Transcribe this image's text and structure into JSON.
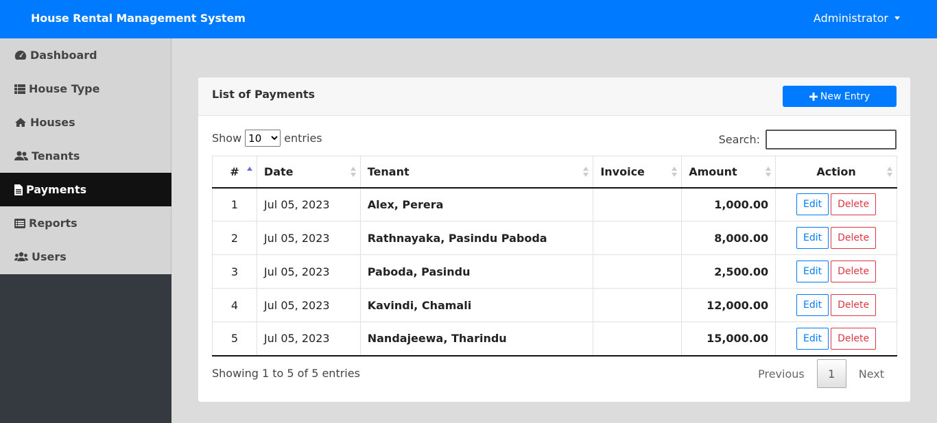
{
  "app": {
    "title": "House Rental Management System",
    "user": "Administrator"
  },
  "sidebar": {
    "items": [
      {
        "label": "Dashboard",
        "icon": "tachometer-icon"
      },
      {
        "label": "House Type",
        "icon": "th-list-icon"
      },
      {
        "label": "Houses",
        "icon": "home-icon"
      },
      {
        "label": "Tenants",
        "icon": "user-friends-icon"
      },
      {
        "label": "Payments",
        "icon": "file-invoice-icon",
        "active": true
      },
      {
        "label": "Reports",
        "icon": "list-alt-icon"
      },
      {
        "label": "Users",
        "icon": "users-icon"
      }
    ]
  },
  "card": {
    "title": "List of Payments",
    "new_entry": "New Entry"
  },
  "table_controls": {
    "show": "Show",
    "entries": "entries",
    "page_size": "10",
    "page_size_options": [
      "10"
    ],
    "search_label": "Search:",
    "search_value": ""
  },
  "table": {
    "columns": [
      "#",
      "Date",
      "Tenant",
      "Invoice",
      "Amount",
      "Action"
    ],
    "rows": [
      {
        "num": "1",
        "date": "Jul 05, 2023",
        "tenant": "Alex, Perera",
        "invoice": "",
        "amount": "1,000.00"
      },
      {
        "num": "2",
        "date": "Jul 05, 2023",
        "tenant": "Rathnayaka, Pasindu Paboda",
        "invoice": "",
        "amount": "8,000.00"
      },
      {
        "num": "3",
        "date": "Jul 05, 2023",
        "tenant": "Paboda, Pasindu",
        "invoice": "",
        "amount": "2,500.00"
      },
      {
        "num": "4",
        "date": "Jul 05, 2023",
        "tenant": "Kavindi, Chamali",
        "invoice": "",
        "amount": "12,000.00"
      },
      {
        "num": "5",
        "date": "Jul 05, 2023",
        "tenant": "Nandajeewa, Tharindu",
        "invoice": "",
        "amount": "15,000.00"
      }
    ],
    "edit_label": "Edit",
    "delete_label": "Delete"
  },
  "footer": {
    "info": "Showing 1 to 5 of 5 entries",
    "previous": "Previous",
    "current_page": "1",
    "next": "Next"
  },
  "colors": {
    "primary": "#007bff",
    "danger": "#dc3545",
    "sidebar_active": "#111111",
    "sidebar_dark": "#343a40"
  }
}
